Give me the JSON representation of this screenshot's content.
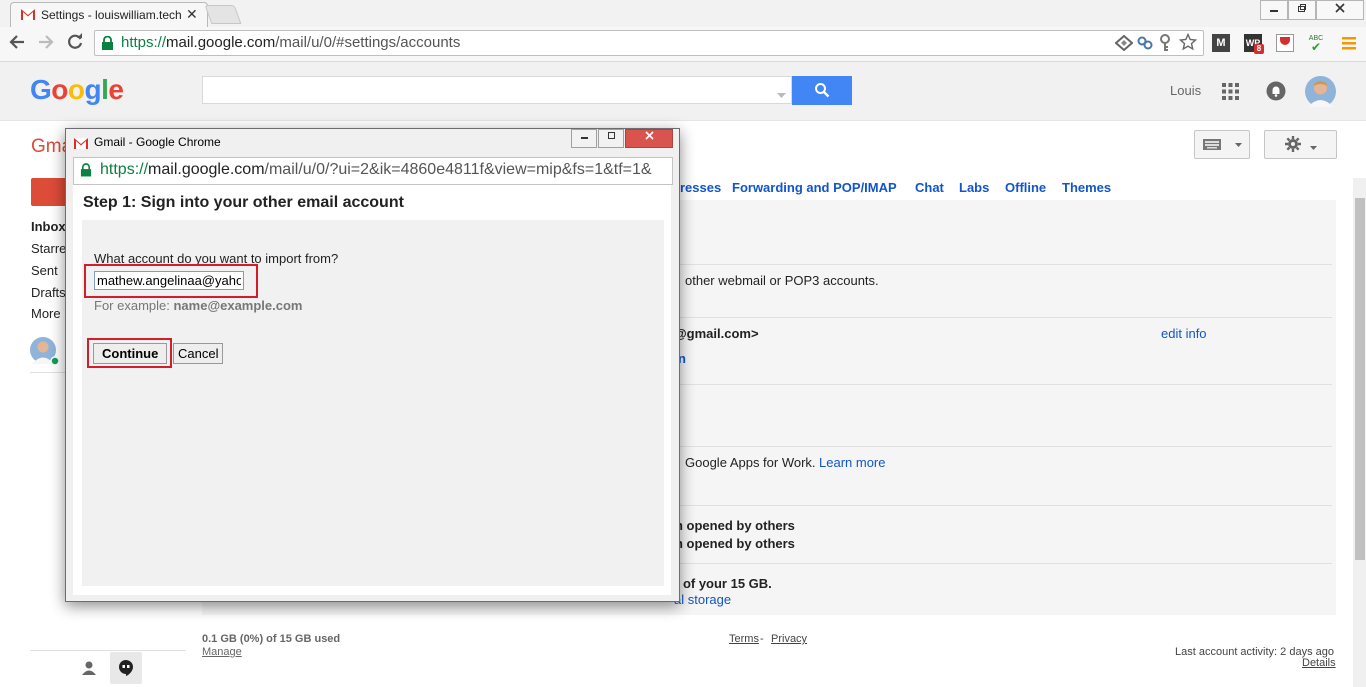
{
  "browser": {
    "tab_title": "Settings - louiswilliam.tech",
    "tab_close": "✕",
    "url_secure": "https://",
    "url_host": "mail.google.com",
    "url_path": "/mail/u/0/#settings/accounts",
    "ext_badge_wp": "8",
    "ext_wp_label": "WP",
    "ext_abc_label": "ABC"
  },
  "google": {
    "logo_letters": [
      "G",
      "o",
      "o",
      "g",
      "l",
      "e"
    ],
    "logo_colors": [
      "#4285f4",
      "#ea4335",
      "#fbbc05",
      "#4285f4",
      "#34a853",
      "#ea4335"
    ],
    "search_placeholder": "",
    "user_name": "Louis"
  },
  "gmail": {
    "label": "Gma",
    "sidebar": [
      "Inbox",
      "Starre",
      "Sent",
      "Drafts",
      "More"
    ],
    "settings_tabs": [
      "resses",
      "Forwarding and POP/IMAP",
      "Chat",
      "Labs",
      "Offline",
      "Themes"
    ],
    "rows": {
      "import_text": "other webmail or POP3 accounts.",
      "send_as": "@gmail.com>",
      "edit_info": "edit info",
      "n_char": "n",
      "apps_text": "Google Apps for Work.",
      "learn_more": "Learn more",
      "opened_1": "n opened by others",
      "opened_2": "n opened by others",
      "storage_text": ") of your 15 GB.",
      "storage_link": "al storage"
    },
    "footer": {
      "usage": "0.1 GB (0%) of 15 GB used",
      "manage": "Manage",
      "terms": "Terms",
      "dash": " - ",
      "privacy": "Privacy",
      "activity": "Last account activity: 2 days ago",
      "details": "Details"
    }
  },
  "popup": {
    "window_title": "Gmail - Google Chrome",
    "url_secure": "https://",
    "url_host": "mail.google.com",
    "url_path": "/mail/u/0/?ui=2&ik=4860e4811f&view=mip&fs=1&tf=1&",
    "heading": "Step 1: Sign into your other email account",
    "question": "What account do you want to import from?",
    "email_value": "mathew.angelinaa@yahoo.com",
    "example_prefix": "For example: ",
    "example_value": "name@example.com",
    "continue_label": "Continue",
    "cancel_label": "Cancel"
  }
}
